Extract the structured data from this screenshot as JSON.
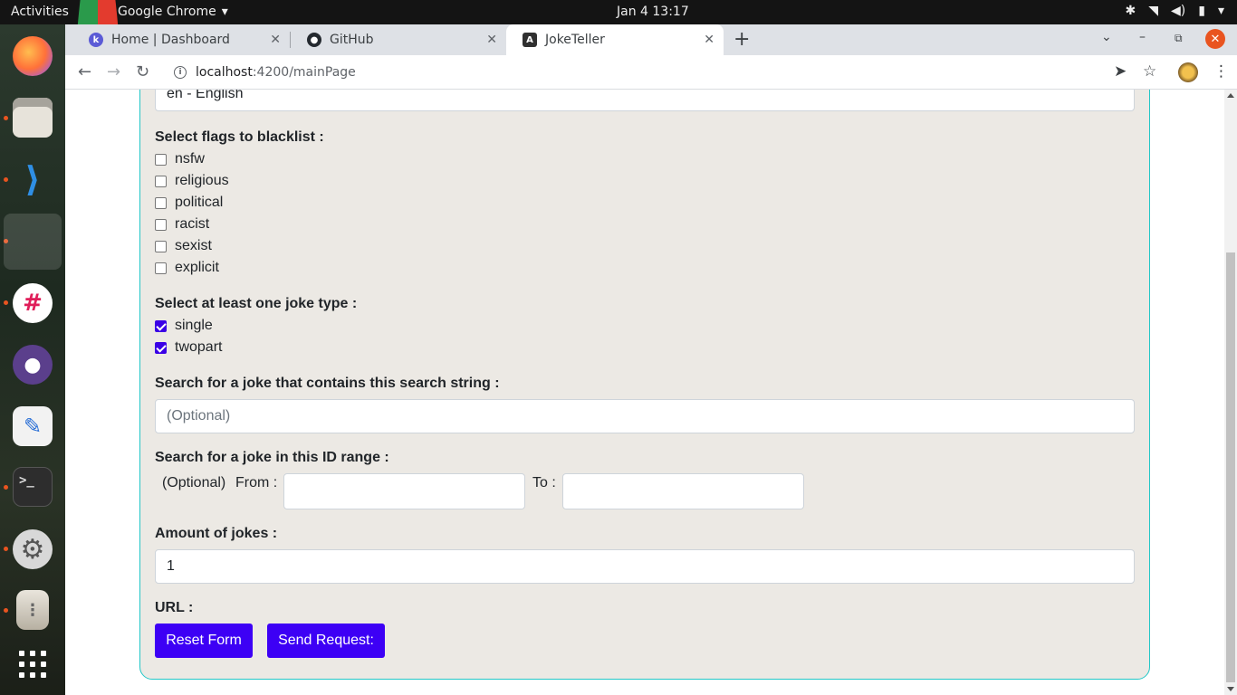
{
  "topbar": {
    "activities": "Activities",
    "app_name": "Google Chrome",
    "clock": "Jan 4  13:17"
  },
  "dock": {
    "apps": [
      "firefox-icon",
      "files-icon",
      "vscode-icon",
      "chrome-icon",
      "slack-icon",
      "github-desktop-icon",
      "text-editor-icon",
      "terminal-icon",
      "settings-icon",
      "archive-icon",
      "show-apps-icon"
    ]
  },
  "browser": {
    "tabs": [
      {
        "title": "Home | Dashboard",
        "favicon": "k"
      },
      {
        "title": "GitHub",
        "favicon": "github"
      },
      {
        "title": "JokeTeller",
        "favicon": "angular",
        "active": true
      }
    ],
    "url_host": "localhost",
    "url_path": ":4200/mainPage"
  },
  "form": {
    "language_value": "en - English",
    "flags_label": "Select flags to blacklist :",
    "flags": [
      {
        "label": "nsfw",
        "checked": false
      },
      {
        "label": "religious",
        "checked": false
      },
      {
        "label": "political",
        "checked": false
      },
      {
        "label": "racist",
        "checked": false
      },
      {
        "label": "sexist",
        "checked": false
      },
      {
        "label": "explicit",
        "checked": false
      }
    ],
    "types_label": "Select at least one joke type :",
    "types": [
      {
        "label": "single",
        "checked": true
      },
      {
        "label": "twopart",
        "checked": true
      }
    ],
    "search_label": "Search for a joke that contains this search string :",
    "search_placeholder": "(Optional)",
    "range_label": "Search for a joke in this ID range :",
    "range_optional": "(Optional)",
    "range_from": "From :",
    "range_to": "To :",
    "amount_label": "Amount of jokes :",
    "amount_value": "1",
    "url_label": "URL :",
    "reset_button": "Reset Form",
    "send_button": "Send Request:"
  }
}
